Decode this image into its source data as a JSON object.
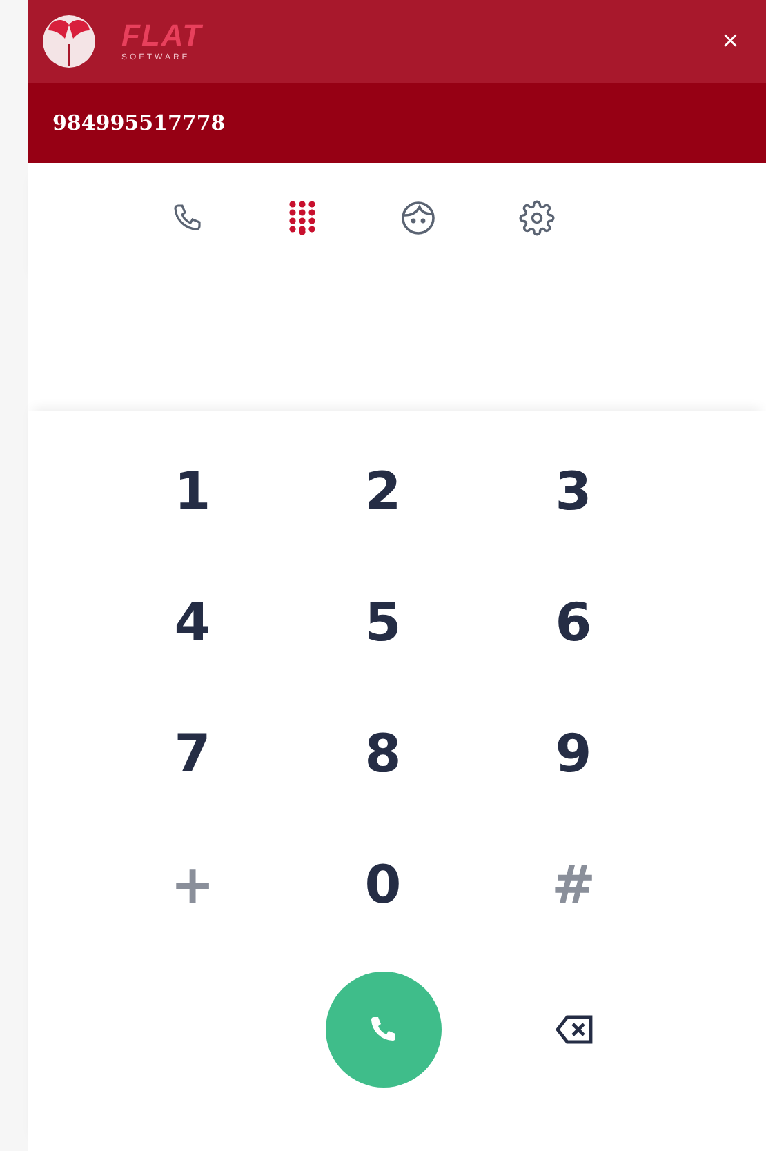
{
  "header": {
    "logo_word": "FLAT",
    "logo_tagline": "SOFTWARE",
    "close": "×"
  },
  "number_field": {
    "value": "984995517778"
  },
  "tabs": [
    {
      "kind": "phone",
      "selected": false
    },
    {
      "kind": "dialpad",
      "selected": true
    },
    {
      "kind": "face",
      "selected": false
    },
    {
      "kind": "settings",
      "selected": false
    }
  ],
  "keys": [
    {
      "label": "1",
      "kind": "digit"
    },
    {
      "label": "2",
      "kind": "digit"
    },
    {
      "label": "3",
      "kind": "digit"
    },
    {
      "label": "4",
      "kind": "digit"
    },
    {
      "label": "5",
      "kind": "digit"
    },
    {
      "label": "6",
      "kind": "digit"
    },
    {
      "label": "7",
      "kind": "digit"
    },
    {
      "label": "8",
      "kind": "digit"
    },
    {
      "label": "9",
      "kind": "digit"
    },
    {
      "label": "+",
      "kind": "symbol"
    },
    {
      "label": "0",
      "kind": "digit"
    },
    {
      "label": "#",
      "kind": "symbol"
    }
  ]
}
